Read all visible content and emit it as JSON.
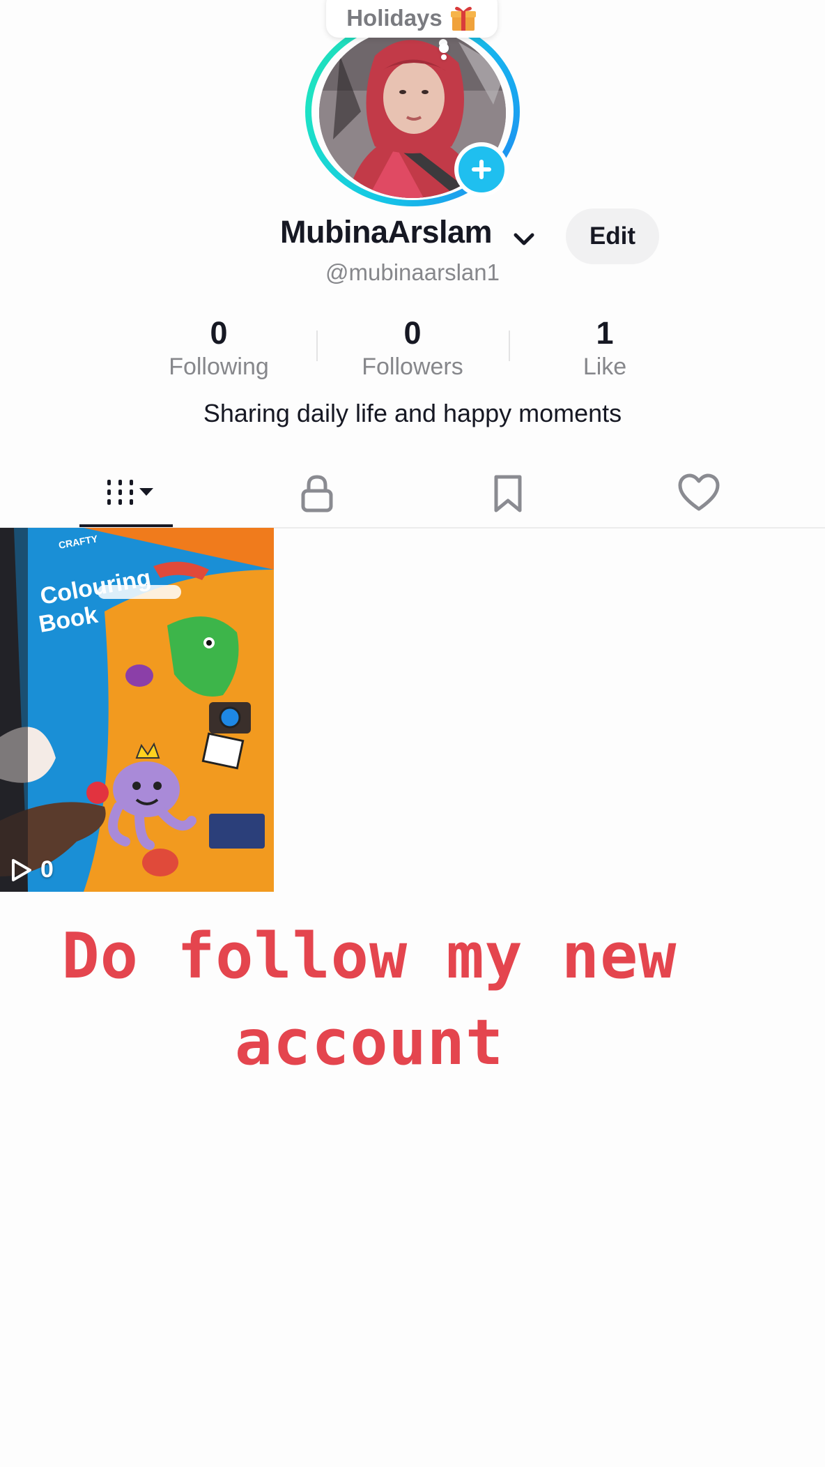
{
  "story_note": {
    "text": "Holidays",
    "icon": "gift-icon"
  },
  "profile": {
    "display_name": "MubinaArslam",
    "handle": "@mubinaarslan1",
    "edit_label": "Edit",
    "bio": "Sharing daily life and happy moments"
  },
  "stats": [
    {
      "value": "0",
      "label": "Following"
    },
    {
      "value": "0",
      "label": "Followers"
    },
    {
      "value": "1",
      "label": "Like"
    }
  ],
  "tabs": [
    {
      "name": "videos",
      "icon": "grid-icon",
      "active": true
    },
    {
      "name": "private",
      "icon": "lock-icon",
      "active": false
    },
    {
      "name": "saved",
      "icon": "bookmark-icon",
      "active": false
    },
    {
      "name": "liked",
      "icon": "heart-icon",
      "active": false
    }
  ],
  "videos": [
    {
      "views": "0",
      "thumbnail": {
        "brand": "CRAFTY",
        "title_line1": "Colouring",
        "title_line2": "Book"
      }
    }
  ],
  "overlay_text": "Do follow my new account",
  "colors": {
    "accent_blue": "#1fbfef",
    "overlay_red": "#e4454e",
    "ring_teal": "#1de3c4"
  }
}
